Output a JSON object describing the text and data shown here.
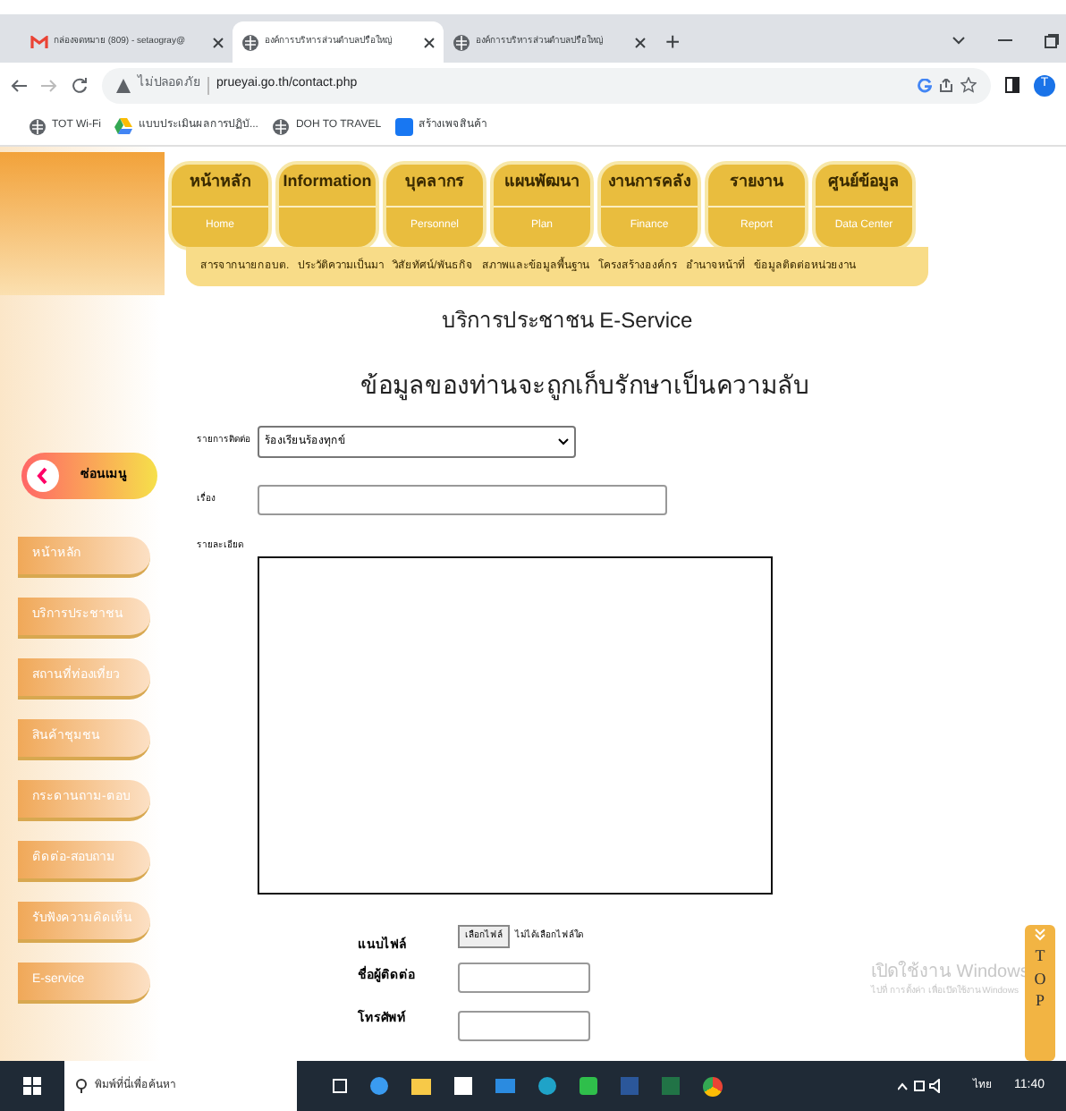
{
  "browser": {
    "tabs": [
      {
        "title": "กล่องจดหมาย (809) - setaogray@",
        "kind": "mail",
        "selected": false
      },
      {
        "title": "องค์การบริหารส่วนตำบลปรือใหญ่",
        "kind": "globe",
        "selected": true
      },
      {
        "title": "องค์การบริหารส่วนตำบลปรือใหญ่",
        "kind": "globe",
        "selected": false
      }
    ],
    "new_tab": "+",
    "security_label": "ไม่ปลอดภัย",
    "url": "prueyai.go.th/contact.php",
    "profile_initial": "T",
    "bookmarks": [
      {
        "label": "TOT Wi-Fi",
        "kind": "globe"
      },
      {
        "label": "แบบประเมินผลการปฏิบั...",
        "kind": "drive"
      },
      {
        "label": "DOH TO TRAVEL",
        "kind": "globe"
      },
      {
        "label": "สร้างเพจสินค้า",
        "kind": "facebook"
      }
    ]
  },
  "nav": {
    "items": [
      {
        "label": "หน้าหลัก",
        "sublabel": "Home"
      },
      {
        "label": "Information"
      },
      {
        "label": "บุคลากร",
        "sublabel": "Personnel"
      },
      {
        "label": "แผนพัฒนา",
        "sublabel": "Plan"
      },
      {
        "label": "งานการคลัง",
        "sublabel": "Finance"
      },
      {
        "label": "รายงาน",
        "sublabel": "Report"
      },
      {
        "label": "ศูนย์ข้อมูล",
        "sublabel": "Data Center"
      }
    ],
    "sub_items": [
      "สารจากนายกอบต.",
      "ประวัติความเป็นมา",
      "วิสัยทัศน์/พันธกิจ",
      "สภาพและข้อมูลพื้นฐาน",
      "โครงสร้างองค์กร",
      "อำนาจหน้าที่",
      "ข้อมูลติดต่อหน่วยงาน"
    ]
  },
  "sidebar": {
    "hide_button": "ซ่อนเมนู",
    "items": [
      "หน้าหลัก",
      "บริการประชาชน",
      "สถานที่ท่องเที่ยว",
      "สินค้าชุมชน",
      "กระดานถาม-ตอบ",
      "ติดต่อ-สอบถาม",
      "รับฟังความคิดเห็น",
      "E-service"
    ]
  },
  "form": {
    "title": "บริการประชาชน E-Service",
    "notice": "ข้อมูลของท่านจะถูกเก็บรักษาเป็นความลับ",
    "contact_type": {
      "label": "รายการติดต่อ",
      "value": "ร้องเรียนร้องทุกข์"
    },
    "subject": {
      "label": "เรื่อง"
    },
    "details": {
      "label": "รายละเอียด"
    },
    "attachment": {
      "label": "แนบไฟล์",
      "button": "เลือกไฟล์",
      "status": "ไม่ได้เลือกไฟล์ใด"
    },
    "contact_name": {
      "label": "ชื่อผู้ติดต่อ"
    },
    "phone": {
      "label": "โทรศัพท์"
    }
  },
  "top_button": "TOP",
  "activation": {
    "title": "เปิดใช้งาน Windows",
    "text": "ไปที่ การตั้งค่า เพื่อเปิดใช้งาน Windows"
  },
  "taskbar": {
    "search_placeholder": "พิมพ์ที่นี่เพื่อค้นหา",
    "language": "ไทย",
    "time": "11:40"
  }
}
